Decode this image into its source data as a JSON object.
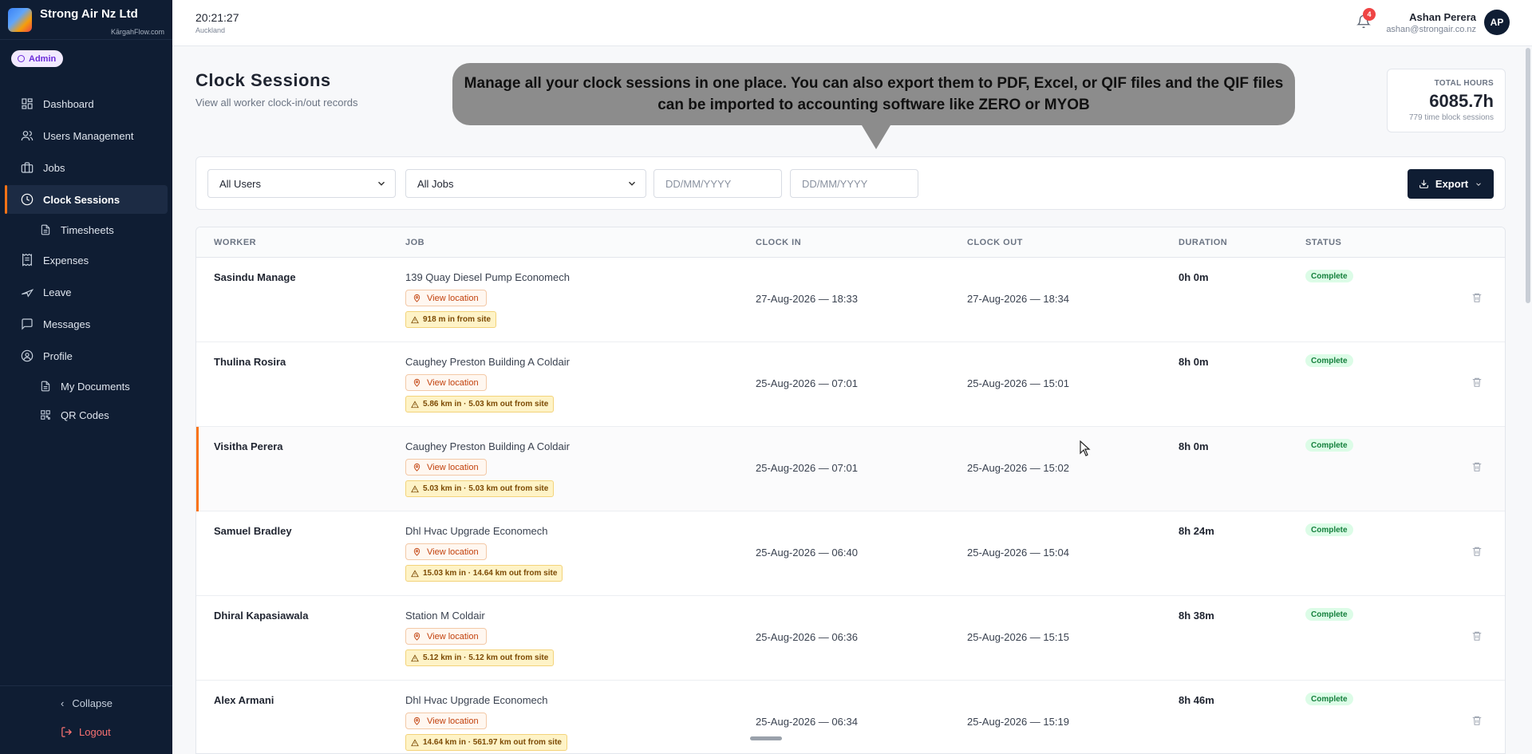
{
  "brand": {
    "name": "Strong Air Nz Ltd",
    "sub": "KārgahFlow.com"
  },
  "role_badge": "Admin",
  "nav": {
    "dashboard": "Dashboard",
    "users": "Users Management",
    "jobs": "Jobs",
    "clock_sessions": "Clock Sessions",
    "timesheets": "Timesheets",
    "expenses": "Expenses",
    "leave": "Leave",
    "messages": "Messages",
    "profile": "Profile",
    "my_documents": "My Documents",
    "qr_codes": "QR Codes",
    "collapse": "Collapse",
    "logout": "Logout"
  },
  "topbar": {
    "time": "20:21:27",
    "timezone": "Auckland",
    "notification_count": "4",
    "user_name": "Ashan Perera",
    "user_email": "ashan@strongair.co.nz",
    "avatar_initials": "AP"
  },
  "page": {
    "title": "Clock Sessions",
    "subtitle": "View all worker clock-in/out records"
  },
  "tooltip": "Manage all your clock sessions in one place. You can also export them to PDF, Excel, or QIF files and the QIF files can be imported to accounting software like ZERO or MYOB",
  "total": {
    "label": "TOTAL HOURS",
    "value": "6085.7h",
    "sub": "779 time block sessions"
  },
  "filters": {
    "users": "All Users",
    "jobs": "All Jobs",
    "date_from": "DD/MM/YYYY",
    "date_to": "DD/MM/YYYY",
    "export": "Export"
  },
  "columns": {
    "worker": "WORKER",
    "job": "JOB",
    "clock_in": "CLOCK IN",
    "clock_out": "CLOCK OUT",
    "duration": "DURATION",
    "status": "STATUS"
  },
  "rows": [
    {
      "worker": "Sasindu Manage",
      "job": "139 Quay Diesel Pump Economech",
      "location": "View location",
      "warning": "918 m in from site",
      "clock_in": "27-Aug-2026 — 18:33",
      "clock_out": "27-Aug-2026 — 18:34",
      "duration": "0h 0m",
      "status": "Complete"
    },
    {
      "worker": "Thulina Rosira",
      "job": "Caughey Preston Building A Coldair",
      "location": "View location",
      "warning": "5.86 km in · 5.03 km out from site",
      "clock_in": "25-Aug-2026 — 07:01",
      "clock_out": "25-Aug-2026 — 15:01",
      "duration": "8h 0m",
      "status": "Complete"
    },
    {
      "worker": "Visitha Perera",
      "job": "Caughey Preston Building A Coldair",
      "location": "View location",
      "warning": "5.03 km in · 5.03 km out from site",
      "clock_in": "25-Aug-2026 — 07:01",
      "clock_out": "25-Aug-2026 — 15:02",
      "duration": "8h 0m",
      "status": "Complete"
    },
    {
      "worker": "Samuel Bradley",
      "job": "Dhl Hvac Upgrade Economech",
      "location": "View location",
      "warning": "15.03 km in · 14.64 km out from site",
      "clock_in": "25-Aug-2026 — 06:40",
      "clock_out": "25-Aug-2026 — 15:04",
      "duration": "8h 24m",
      "status": "Complete"
    },
    {
      "worker": "Dhiral Kapasiawala",
      "job": "Station M Coldair",
      "location": "View location",
      "warning": "5.12 km in · 5.12 km out from site",
      "clock_in": "25-Aug-2026 — 06:36",
      "clock_out": "25-Aug-2026 — 15:15",
      "duration": "8h 38m",
      "status": "Complete"
    },
    {
      "worker": "Alex Armani",
      "job": "Dhl Hvac Upgrade Economech",
      "location": "View location",
      "warning": "14.64 km in · 561.97 km out from site",
      "clock_in": "25-Aug-2026 — 06:34",
      "clock_out": "25-Aug-2026 — 15:19",
      "duration": "8h 46m",
      "status": "Complete"
    }
  ],
  "colors": {
    "sidebar": "#0f1d33",
    "accent": "#f97316",
    "status_green": "#15803d"
  }
}
